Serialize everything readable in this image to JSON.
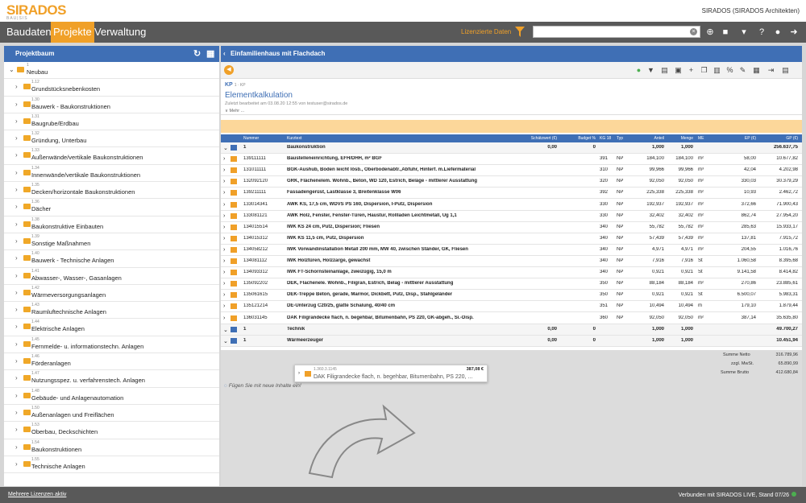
{
  "header": {
    "brand": "SIRADOS",
    "brand_sub": "BAU|SIS",
    "account": "SIRADOS (SIRADOS Architekten)",
    "licensed": "Lizenzierte Daten",
    "search_value": ""
  },
  "nav": {
    "tabs": [
      "Baudaten",
      "Projekte",
      "Verwaltung"
    ],
    "active": "Projekte"
  },
  "tree": {
    "title": "Projektbaum",
    "root": {
      "code": "1",
      "label": "Neubau"
    },
    "items": [
      {
        "code": "1.12",
        "label": "Grundstücksnebenkosten"
      },
      {
        "code": "1.30",
        "label": "Bauwerk - Baukonstruktionen"
      },
      {
        "code": "1.31",
        "label": "Baugrube/Erdbau"
      },
      {
        "code": "1.32",
        "label": "Gründung, Unterbau"
      },
      {
        "code": "1.33",
        "label": "Außenwände/vertikale Baukonstruktionen"
      },
      {
        "code": "1.34",
        "label": "Innenwände/vertikale Baukonstruktionen"
      },
      {
        "code": "1.35",
        "label": "Decken/horizontale Baukonstruktionen"
      },
      {
        "code": "1.36",
        "label": "Dächer"
      },
      {
        "code": "1.38",
        "label": "Baukonstruktive Einbauten"
      },
      {
        "code": "1.39",
        "label": "Sonstige Maßnahmen"
      },
      {
        "code": "1.40",
        "label": "Bauwerk - Technische Anlagen"
      },
      {
        "code": "1.41",
        "label": "Abwasser-, Wasser-, Gasanlagen"
      },
      {
        "code": "1.42",
        "label": "Wärmeversorgungsanlagen"
      },
      {
        "code": "1.43",
        "label": "Raumluftechnische Anlagen"
      },
      {
        "code": "1.44",
        "label": "Elektrische Anlagen"
      },
      {
        "code": "1.45",
        "label": "Fernmelde- u. informationstechn. Anlagen"
      },
      {
        "code": "1.46",
        "label": "Förderanlagen"
      },
      {
        "code": "1.47",
        "label": "Nutzungsspez. u. verfahrenstech. Anlagen"
      },
      {
        "code": "1.48",
        "label": "Gebäude- und Anlagenautomation"
      },
      {
        "code": "1.50",
        "label": "Außenanlagen und Freiflächen"
      },
      {
        "code": "1.53",
        "label": "Oberbau, Deckschichten"
      },
      {
        "code": "1.54",
        "label": "Baukonstruktionen"
      },
      {
        "code": "1.55",
        "label": "Technische Anlagen"
      }
    ]
  },
  "main": {
    "title": "Einfamilienhaus mit Flachdach",
    "kp_code": "KP",
    "kp_sub": "1 · KP",
    "kp_title": "Elementkalkulation",
    "kp_edited": "Zuletzt bearbeitet am 03.08.20 12:55 von testuser@sirados.de",
    "kp_more": "∨ Mehr ...",
    "columns": [
      "Nummer",
      "Kurztext",
      "Schätzwert (€)",
      "Budget %",
      "KG 18",
      "Typ",
      "Anteil",
      "Menge",
      "ME",
      "EP (€)",
      "GP (€)"
    ],
    "rows": [
      {
        "n": "1",
        "t": "Baukonstruktion",
        "s": "0,00",
        "b": "0",
        "kg": "",
        "ty": "",
        "a": "1,000",
        "m": "1,000",
        "me": "",
        "ep": "",
        "gp": "256.637,75",
        "grp": true
      },
      {
        "n": "139111111",
        "t": "Baustelleneinrichtung, EFH/DHH, m² BGF",
        "kg": "391",
        "ty": "NP",
        "a": "184,100",
        "m": "184,100",
        "me": "m²",
        "ep": "58,00",
        "gp": "10.677,82"
      },
      {
        "n": "131011111",
        "t": "BGK-Aushub, Boden leicht lösb., Oberbodenabtr.,Abfuhr, Hinterf. m.Liefermaterial",
        "kg": "310",
        "ty": "NP",
        "a": "99,966",
        "m": "99,966",
        "me": "m³",
        "ep": "42,04",
        "gp": "4.202,98"
      },
      {
        "n": "132092120",
        "t": "GRK, Flächenelem. Wohnb., Beton, WD 120, Estrich, Beläge - mittlerer Ausstattung",
        "kg": "320",
        "ty": "NP",
        "a": "92,050",
        "m": "92,050",
        "me": "m²",
        "ep": "330,03",
        "gp": "30.379,29"
      },
      {
        "n": "139211111",
        "t": "Fassadengerüst, Lastklasse 3, Breitenklasse W06",
        "kg": "392",
        "ty": "NP",
        "a": "225,338",
        "m": "225,338",
        "me": "m²",
        "ep": "10,93",
        "gp": "2.462,72"
      },
      {
        "n": "133014341",
        "t": "AWK KS, 17,5 cm, WDVS PS 160, Dispersion, I-Putz, Dispersion",
        "kg": "330",
        "ty": "NP",
        "a": "192,937",
        "m": "192,937",
        "me": "m²",
        "ep": "372,66",
        "gp": "71.900,43"
      },
      {
        "n": "133081121",
        "t": "AWK Holz, Fenster, Fenster-Türen, Haustur, Rollladen Leichtmetall, Ug 1,1",
        "kg": "330",
        "ty": "NP",
        "a": "32,402",
        "m": "32,402",
        "me": "m²",
        "ep": "862,74",
        "gp": "27.954,20"
      },
      {
        "n": "134015514",
        "t": "IWK KS 24 cm, Putz, Dispersion; Fliesen",
        "kg": "340",
        "ty": "NP",
        "a": "55,782",
        "m": "55,782",
        "me": "m²",
        "ep": "285,63",
        "gp": "15.933,17"
      },
      {
        "n": "134015312",
        "t": "IWK KS 11,5 cm, Putz, Dispersion",
        "kg": "340",
        "ty": "NP",
        "a": "57,439",
        "m": "57,439",
        "me": "m²",
        "ep": "137,81",
        "gp": "7.915,72"
      },
      {
        "n": "134058212",
        "t": "IWK Vorwandinstallation Metall 200 mm, MW 40, zwischen Ständer, GK, Fliesen",
        "kg": "340",
        "ty": "NP",
        "a": "4,971",
        "m": "4,971",
        "me": "m²",
        "ep": "204,55",
        "gp": "1.016,76"
      },
      {
        "n": "134081112",
        "t": "IWK Holztüren, Holzzarge, gewachst",
        "kg": "340",
        "ty": "NP",
        "a": "7,916",
        "m": "7,916",
        "me": "St",
        "ep": "1.060,58",
        "gp": "8.395,68"
      },
      {
        "n": "134093312",
        "t": "IWK FT-Schornsteinanlage, zweizügig, 15,0 m",
        "kg": "340",
        "ty": "NP",
        "a": "0,921",
        "m": "0,921",
        "me": "St",
        "ep": "9.141,58",
        "gp": "8.414,82"
      },
      {
        "n": "135092202",
        "t": "DEK, Flachenele. Wohnb., Filigran, Estrich, Belag - mittlerer Ausstattung",
        "kg": "350",
        "ty": "NP",
        "a": "88,184",
        "m": "88,184",
        "me": "m²",
        "ep": "270,86",
        "gp": "23.885,61"
      },
      {
        "n": "135061615",
        "t": "DEK-Treppe Beton, gerade, Marmor, Dickbett, Putz, Disp., Stahlgeländer",
        "kg": "350",
        "ty": "NP",
        "a": "0,921",
        "m": "0,921",
        "me": "St",
        "ep": "6.500,07",
        "gp": "5.983,31"
      },
      {
        "n": "135121214",
        "t": "DE-Unterzug C20/25, glatte Schalung, 40/40 cm",
        "kg": "351",
        "ty": "NP",
        "a": "10,494",
        "m": "10,494",
        "me": "m",
        "ep": "179,10",
        "gp": "1.879,44"
      },
      {
        "n": "136031145",
        "t": "DAK Filigrandecke flach, n. begehbar, Bitumenbahn, PS 220, GK-abgeh., Si.-Disp.",
        "kg": "360",
        "ty": "NP",
        "a": "92,050",
        "m": "92,050",
        "me": "m²",
        "ep": "387,14",
        "gp": "35.635,80"
      },
      {
        "n": "1",
        "t": "Technik",
        "s": "0,00",
        "b": "0",
        "kg": "",
        "ty": "",
        "a": "1,000",
        "m": "1,000",
        "me": "",
        "ep": "",
        "gp": "49.700,27",
        "grp": true
      },
      {
        "n": "1",
        "t": "Wärmeerzeuger",
        "s": "0,00",
        "b": "0",
        "kg": "",
        "ty": "",
        "a": "1,000",
        "m": "1,000",
        "me": "",
        "ep": "",
        "gp": "10.451,94",
        "grp": true
      }
    ],
    "totals": {
      "netto_label": "Summe Netto",
      "netto": "316.789,96",
      "mwst_label": "zzgl. MwSt.",
      "mwst": "65.890,99",
      "brutto_label": "Summe Brutto",
      "brutto": "412.680,84"
    },
    "hint": "Fügen Sie mit     neue Inhalte ein!",
    "popup": {
      "code": "1.360.3.1145",
      "price": "387,08 €",
      "text": "DAK Filigrandecke flach, n. begehbar, Bitumenbahn, PS 220, ..."
    }
  },
  "footer": {
    "licenses": "Mehrere Lizenzen aktiv",
    "status": "Verbunden mit SIRADOS LIVE, Stand 07/26"
  },
  "colors": {
    "accent": "#f0a028",
    "blue": "#3f6fb5",
    "nav": "#595959"
  }
}
